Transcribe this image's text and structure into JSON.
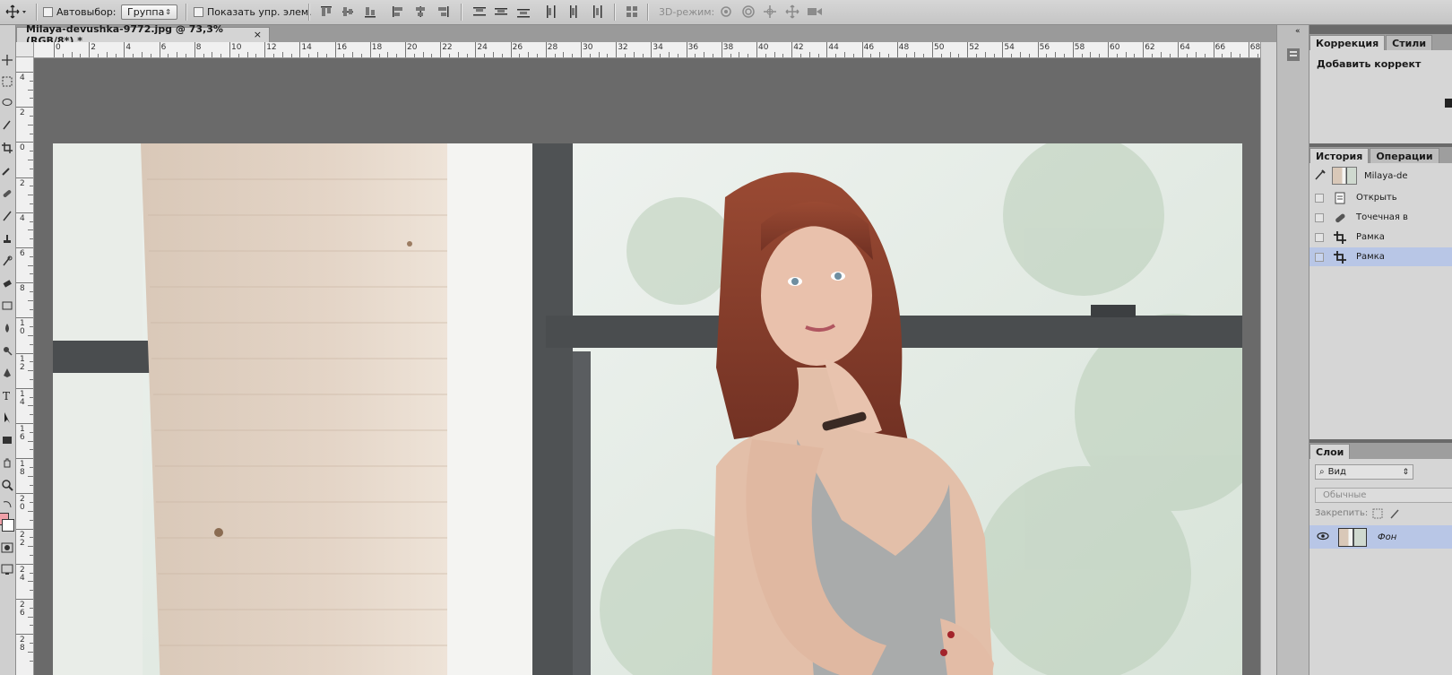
{
  "options_bar": {
    "autoselect_label": "Автовыбор:",
    "autoselect_value": "Группа",
    "show_controls_label": "Показать упр. элем.",
    "mode_3d_label": "3D-режим:"
  },
  "document": {
    "tab_title": "Milaya-devushka-9772.jpg @ 73,3% (RGB/8*) *",
    "close_glyph": "×"
  },
  "rulers": {
    "horizontal": [
      "0",
      "2",
      "4",
      "6",
      "8",
      "10",
      "12",
      "14",
      "16",
      "18",
      "20",
      "22",
      "24",
      "26",
      "28",
      "30",
      "32",
      "34",
      "36",
      "38",
      "40",
      "42",
      "44",
      "46",
      "48",
      "50",
      "52",
      "54",
      "56",
      "58",
      "60",
      "62",
      "64",
      "66",
      "68"
    ],
    "vertical": [
      "4",
      "2",
      "0",
      "2",
      "4",
      "6",
      "8",
      "10",
      "12",
      "14",
      "16",
      "18",
      "20",
      "22",
      "24",
      "26",
      "28"
    ]
  },
  "adjustments_panel": {
    "tabs": [
      "Коррекция",
      "Стили"
    ],
    "heading": "Добавить коррект"
  },
  "history_panel": {
    "tabs": [
      "История",
      "Операции"
    ],
    "snapshot_label": "Milaya-de",
    "items": [
      {
        "label": "Открыть",
        "icon": "document-icon"
      },
      {
        "label": "Точечная в",
        "icon": "spot-healing-icon"
      },
      {
        "label": "Рамка",
        "icon": "crop-icon"
      },
      {
        "label": "Рамка",
        "icon": "crop-icon",
        "selected": true
      }
    ]
  },
  "layers_panel": {
    "tabs": [
      "Слои"
    ],
    "filter_label": "Вид",
    "blend_mode": "Обычные",
    "lock_label": "Закрепить:",
    "layers": [
      {
        "name": "Фон"
      }
    ]
  },
  "colors": {
    "selection": "#b8c6e6",
    "foreground": "#f0a0a8"
  }
}
